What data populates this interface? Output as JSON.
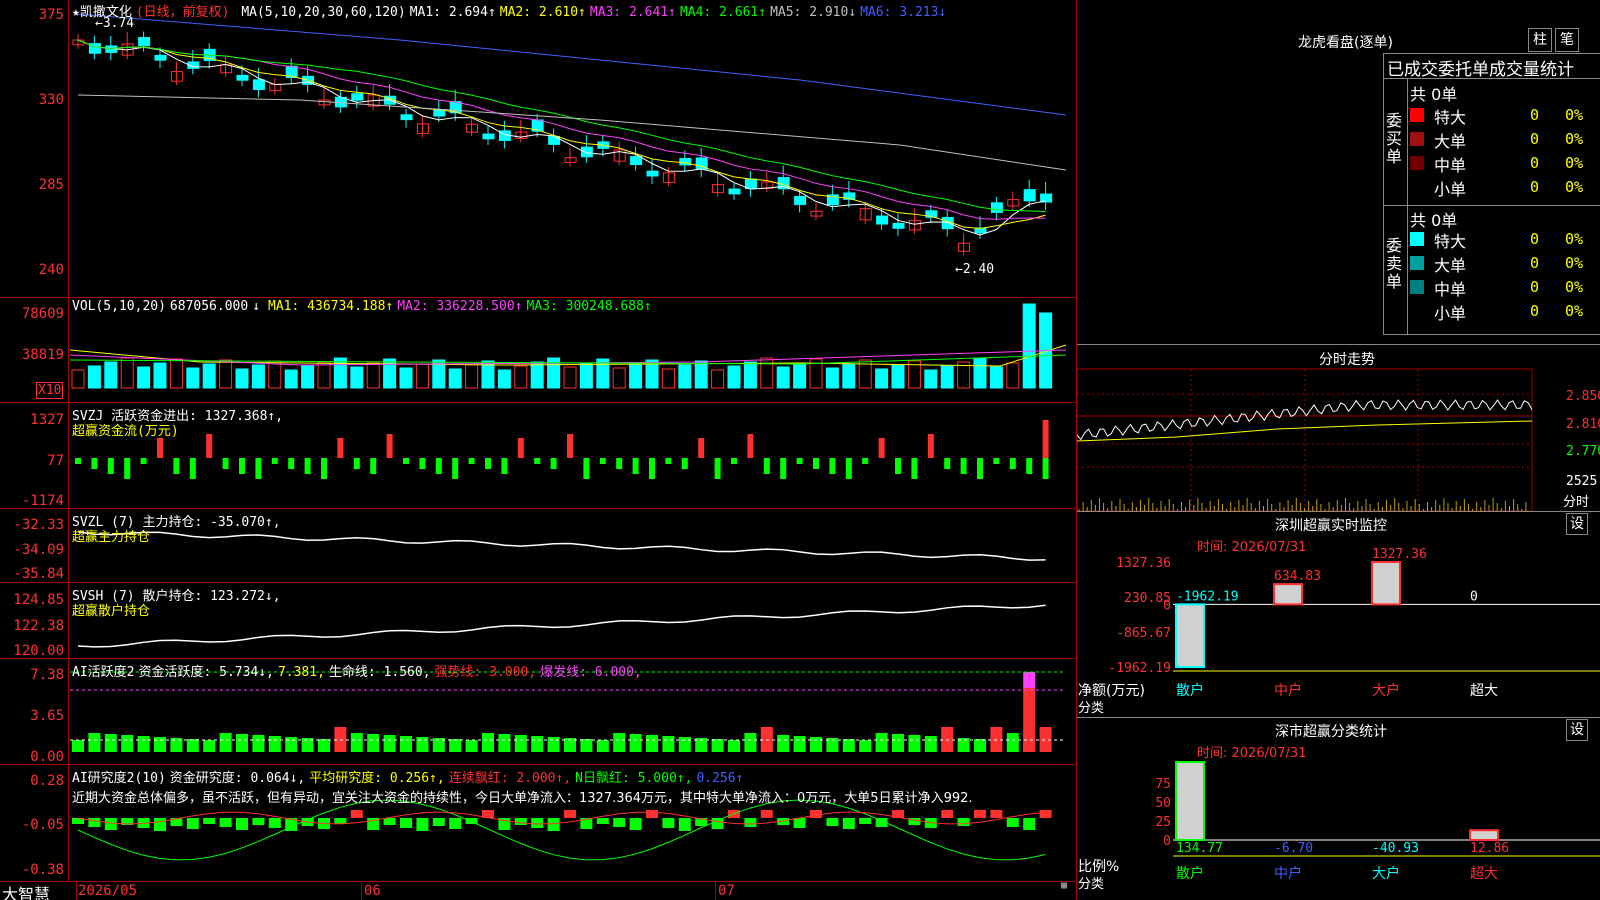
{
  "colors": {
    "up": "#ff3030",
    "down": "#00ffff",
    "grid": "#a00000",
    "green": "#00ff00",
    "yellow": "#ffff00",
    "magenta": "#ff40ff",
    "white": "#ffffff"
  },
  "kline": {
    "stock_name": "★凯撒文化",
    "period": "(日线，前复权)",
    "ma_label": "MA(5,10,20,30,60,120)",
    "ma": [
      {
        "name": "MA1:",
        "value": "2.694",
        "arrow": "↑",
        "color": "#ffffff"
      },
      {
        "name": "MA2:",
        "value": "2.610",
        "arrow": "↑",
        "color": "#ffff00"
      },
      {
        "name": "MA3:",
        "value": "2.641",
        "arrow": "↑",
        "color": "#ff40ff"
      },
      {
        "name": "MA4:",
        "value": "2.661",
        "arrow": "↑",
        "color": "#00ff00"
      },
      {
        "name": "MA5:",
        "value": "2.910",
        "arrow": "↓",
        "color": "#c0c0c0"
      },
      {
        "name": "MA6:",
        "value": "3.213",
        "arrow": "↓",
        "color": "#4060ff"
      }
    ],
    "y_ticks": [
      "375",
      "330",
      "285",
      "240"
    ],
    "high_mark": "3.74",
    "low_mark": "←2.40"
  },
  "vol": {
    "legend_name": "VOL(5,10,20)",
    "value": "687056.000",
    "value_arrow": "↓",
    "ma": [
      {
        "name": "MA1:",
        "value": "436734.188",
        "arrow": "↑",
        "color": "#ffff00"
      },
      {
        "name": "MA2:",
        "value": "336228.500",
        "arrow": "↑",
        "color": "#ff40ff"
      },
      {
        "name": "MA3:",
        "value": "300248.688",
        "arrow": "↑",
        "color": "#00ff00"
      }
    ],
    "y_ticks": [
      "78609",
      "38819"
    ],
    "unit": "X10"
  },
  "svzj": {
    "legend": "SVZJ  活跃资金进出: 1327.368↑,",
    "legend2": "超赢资金流(万元)",
    "y_ticks": [
      "1327",
      "77",
      "-1174"
    ]
  },
  "svzl": {
    "legend": "SVZL (7) 主力持仓: -35.070↑,",
    "legend2": "超赢主力持仓",
    "y_ticks": [
      "-32.33",
      "-34.09",
      "-35.84"
    ]
  },
  "svsh": {
    "legend": "SVSH (7) 散户持仓: 123.272↓,",
    "legend2": "超赢散户持仓",
    "y_ticks": [
      "124.85",
      "122.38",
      "120.00"
    ]
  },
  "ai_active": {
    "legend_name": "AI活跃度2",
    "parts": [
      {
        "text": "资金活跃度: 5.734↓,",
        "color": "#ffffff"
      },
      {
        "text": "7.381,",
        "color": "#ffff00"
      },
      {
        "text": "生命线: 1.560,",
        "color": "#ffffff"
      },
      {
        "text": "强势线: 3.000,",
        "color": "#ff3030"
      },
      {
        "text": "爆发线: 6.000,",
        "color": "#ff40ff"
      }
    ],
    "y_ticks": [
      "7.38",
      "3.65",
      "0.00"
    ]
  },
  "ai_research": {
    "legend_name": "AI研究度2(10)",
    "parts": [
      {
        "text": "资金研究度: 0.064↓,",
        "color": "#ffffff"
      },
      {
        "text": "平均研究度: 0.256↑,",
        "color": "#ffff00"
      },
      {
        "text": "连续飘红: 2.000↑,",
        "color": "#ff3030"
      },
      {
        "text": "N日飘红: 5.000↑,",
        "color": "#00ff00"
      },
      {
        "text": "0.256↑",
        "color": "#4060ff"
      }
    ],
    "comment": "近期大资金总体偏多，虽不活跃，但有异动，宜关注大资金的持续性，今日大单净流入：1327.364万元，其中特大单净流入：0万元，大单5日累计净入992.",
    "y_ticks": [
      "0.28",
      "-0.05",
      "-0.38"
    ]
  },
  "xaxis": {
    "brand": "大智慧",
    "labels": [
      "2026/05",
      "06",
      "07"
    ]
  },
  "longhu": {
    "title": "龙虎看盘(逐单)",
    "btn1": "柱",
    "btn2": "笔",
    "header": "已成交委托单成交量统计",
    "buy_label": "委买单",
    "sell_label": "委卖单",
    "buy_total": "共 0单",
    "sell_total": "共 0单",
    "buy_rows": [
      {
        "label": "特大",
        "count": "0",
        "pct": "0%",
        "color": "#ff0000"
      },
      {
        "label": "大单",
        "count": "0",
        "pct": "0%",
        "color": "#a01010"
      },
      {
        "label": "中单",
        "count": "0",
        "pct": "0%",
        "color": "#700000"
      },
      {
        "label": "小单",
        "count": "0",
        "pct": "0%",
        "color": ""
      }
    ],
    "sell_rows": [
      {
        "label": "特大",
        "count": "0",
        "pct": "0%",
        "color": "#00ffff"
      },
      {
        "label": "大单",
        "count": "0",
        "pct": "0%",
        "color": "#00a0a0"
      },
      {
        "label": "中单",
        "count": "0",
        "pct": "0%",
        "color": "#008080"
      },
      {
        "label": "小单",
        "count": "0",
        "pct": "0%",
        "color": ""
      }
    ]
  },
  "intraday": {
    "title": "分时走势",
    "y_ticks": [
      "2.850",
      "2.810",
      "2.770"
    ],
    "vol_tick": "2525",
    "vol_label": "分时"
  },
  "sz_monitor": {
    "title": "深圳超赢实时监控",
    "set_btn": "设",
    "time": "时间: 2026/07/31",
    "y_ticks": [
      "1327.36",
      "230.85",
      "0",
      "-865.67",
      "-1962.19"
    ],
    "axis_title": "净额(万元)",
    "axis_sub": "分类",
    "bars": [
      {
        "label": "散户",
        "value": -1962.19,
        "text": "-1962.19",
        "color": "#00ffff"
      },
      {
        "label": "中户",
        "value": 634.83,
        "text": "634.83",
        "color": "#ff3030"
      },
      {
        "label": "大户",
        "value": 1327.36,
        "text": "1327.36",
        "color": "#ff3030"
      },
      {
        "label": "超大",
        "value": 0,
        "text": "0",
        "color": "#ffffff"
      }
    ]
  },
  "sz_stats": {
    "title": "深市超赢分类统计",
    "set_btn": "设",
    "time": "时间: 2026/07/31",
    "y_ticks": [
      "75",
      "50",
      "25",
      "0"
    ],
    "axis_title": "比例%",
    "axis_sub": "分类",
    "bars": [
      {
        "label": "散户",
        "value": 134.77,
        "text": "134.77",
        "color": "#00ff00"
      },
      {
        "label": "中户",
        "value": -6.7,
        "text": "-6.70",
        "color": "#4060ff"
      },
      {
        "label": "大户",
        "value": -40.93,
        "text": "-40.93",
        "color": "#00ffff"
      },
      {
        "label": "超大",
        "value": 12.86,
        "text": "12.86",
        "color": "#ff3030"
      }
    ]
  }
}
